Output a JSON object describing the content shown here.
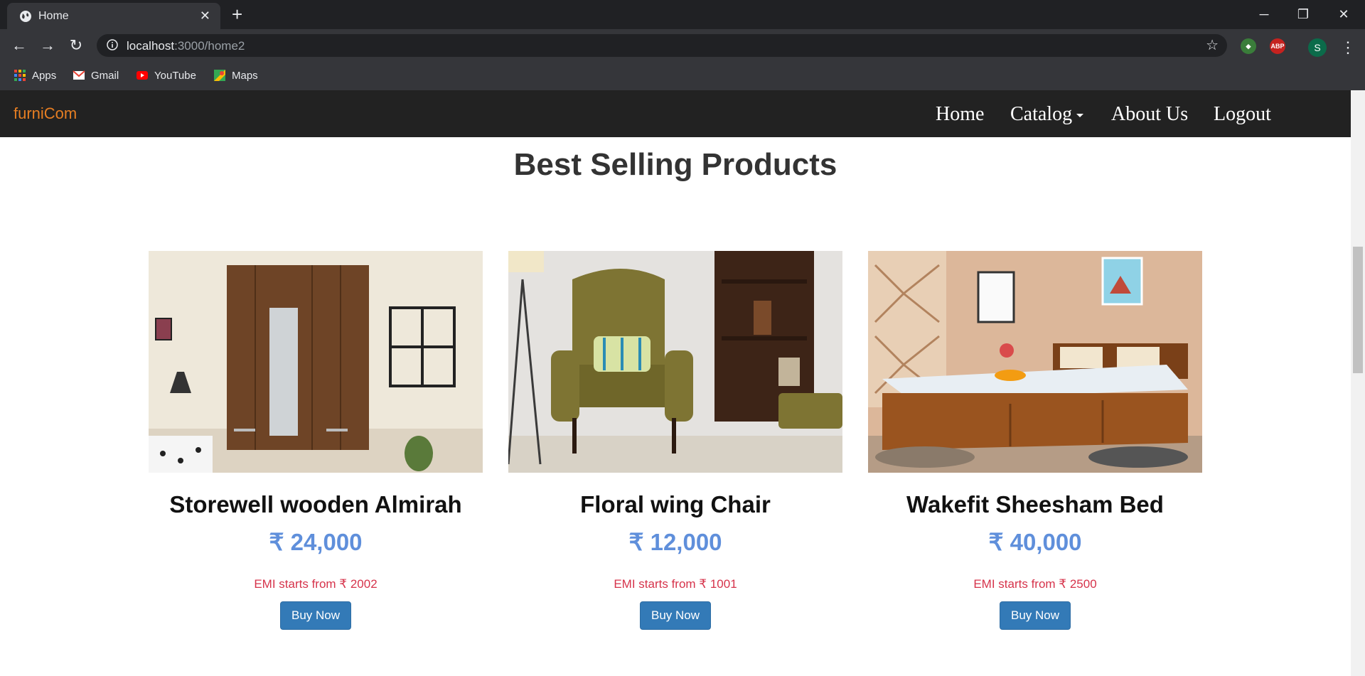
{
  "browser": {
    "tab_title": "Home",
    "url_host": "localhost",
    "url_path": ":3000/home2",
    "profile_initial": "S",
    "bookmarks": [
      {
        "label": "Apps",
        "icon": "apps-grid-icon"
      },
      {
        "label": "Gmail",
        "icon": "gmail-icon"
      },
      {
        "label": "YouTube",
        "icon": "youtube-icon"
      },
      {
        "label": "Maps",
        "icon": "maps-icon"
      }
    ],
    "extension_abp_label": "ABP"
  },
  "site": {
    "brand": "furniCom",
    "brand_color": "#e67e22",
    "nav": [
      {
        "label": "Home"
      },
      {
        "label": "Catalog"
      },
      {
        "label": "About Us"
      },
      {
        "label": "Logout"
      }
    ]
  },
  "main": {
    "heading": "Best Selling Products",
    "products": [
      {
        "name": "Storewell wooden Almirah",
        "price": "₹ 24,000",
        "emi": "EMI starts from ₹ 2002",
        "button": "Buy Now",
        "image": "wardrobe"
      },
      {
        "name": "Floral wing Chair",
        "price": "₹ 12,000",
        "emi": "EMI starts from ₹ 1001",
        "button": "Buy Now",
        "image": "wing-chair"
      },
      {
        "name": "Wakefit Sheesham Bed",
        "price": "₹ 40,000",
        "emi": "EMI starts from ₹ 2500",
        "button": "Buy Now",
        "image": "bed"
      }
    ]
  },
  "colors": {
    "price": "#5f8fdb",
    "emi": "#d6334b",
    "button": "#337ab7",
    "navbar": "#222222"
  }
}
